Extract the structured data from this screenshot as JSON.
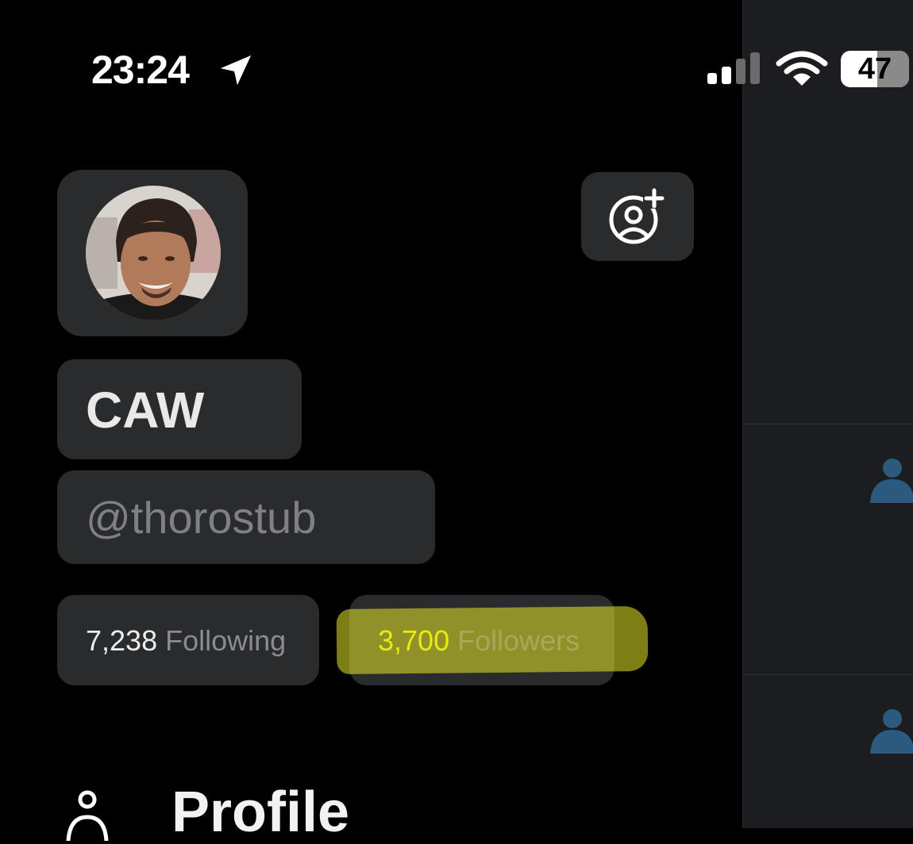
{
  "status_bar": {
    "time": "23:24",
    "battery": "47",
    "location_icon": "location-arrow-icon",
    "signal_icon": "cellular-signal-icon",
    "wifi_icon": "wifi-icon"
  },
  "profile": {
    "display_name": "CAW",
    "handle": "@thorostub",
    "following_count": "7,238",
    "following_label": "Following",
    "followers_count": "3,700",
    "followers_label": "Followers",
    "add_account_icon": "add-account-icon",
    "highlight_color": "#e6e628"
  },
  "menu": {
    "items": [
      {
        "label": "Profile",
        "icon": "person-icon"
      }
    ]
  },
  "colors": {
    "background": "#000000",
    "skeleton": "#2a2b2d",
    "feed_background": "#1b1d20",
    "feed_avatar": "#2b5a7e"
  }
}
